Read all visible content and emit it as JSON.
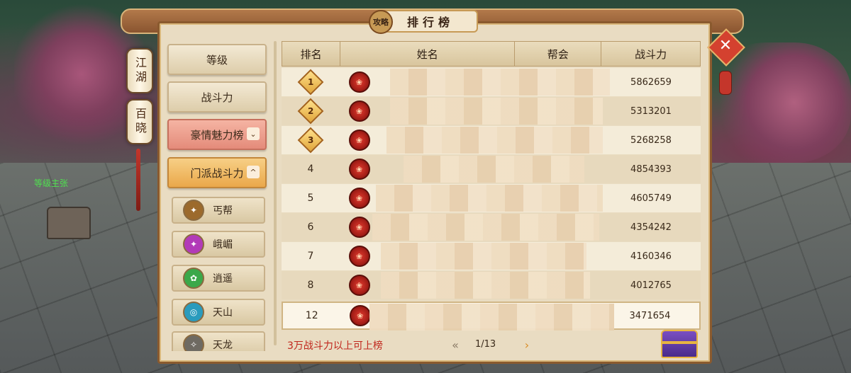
{
  "background": {
    "player_label": "等级主张"
  },
  "lanterns": [
    {
      "label": "江湖"
    },
    {
      "label": "百晓"
    }
  ],
  "header": {
    "badge": "攻略",
    "title": "排行榜",
    "close_icon": "close-x-icon"
  },
  "sidebar": {
    "categories": [
      {
        "label": "等级",
        "style": "normal"
      },
      {
        "label": "战斗力",
        "style": "normal"
      },
      {
        "label": "豪情魅力榜",
        "style": "pink",
        "chevron": "⌄"
      },
      {
        "label": "门派战斗力",
        "style": "orange",
        "chevron": "^"
      }
    ],
    "sects": [
      {
        "label": "丐帮",
        "icon": "staff-icon",
        "color": "#9c6a2c"
      },
      {
        "label": "峨嵋",
        "icon": "blade-icon",
        "color": "#b23ab8"
      },
      {
        "label": "逍遥",
        "icon": "lotus-icon",
        "color": "#3ba84a"
      },
      {
        "label": "天山",
        "icon": "ring-icon",
        "color": "#2a9bbd"
      },
      {
        "label": "天龙",
        "icon": "dragon-icon",
        "color": "#6e6a62"
      }
    ]
  },
  "table": {
    "headers": {
      "rank": "排名",
      "name": "姓名",
      "guild": "帮会",
      "power": "战斗力"
    },
    "rows": [
      {
        "rank": "1",
        "power": "5862659",
        "medal": "gold-red"
      },
      {
        "rank": "2",
        "power": "5313201",
        "medal": "gold"
      },
      {
        "rank": "3",
        "power": "5268258",
        "medal": "gold-blue"
      },
      {
        "rank": "4",
        "power": "4854393"
      },
      {
        "rank": "5",
        "power": "4605749"
      },
      {
        "rank": "6",
        "power": "4354242"
      },
      {
        "rank": "7",
        "power": "4160346"
      },
      {
        "rank": "8",
        "power": "4012765"
      }
    ],
    "self_row": {
      "rank": "12",
      "power": "3471654"
    }
  },
  "footer": {
    "note": "3万战斗力以上可上榜",
    "pager": "1/13",
    "prev_icon": "chevron-left-icon",
    "next_icon": "chevron-right-icon",
    "reward_icon": "treasure-chest-icon"
  },
  "colors": {
    "accent_red": "#c0261c",
    "panel_bg": "#e9dcc2",
    "frame_brown": "#8a5a2e"
  }
}
